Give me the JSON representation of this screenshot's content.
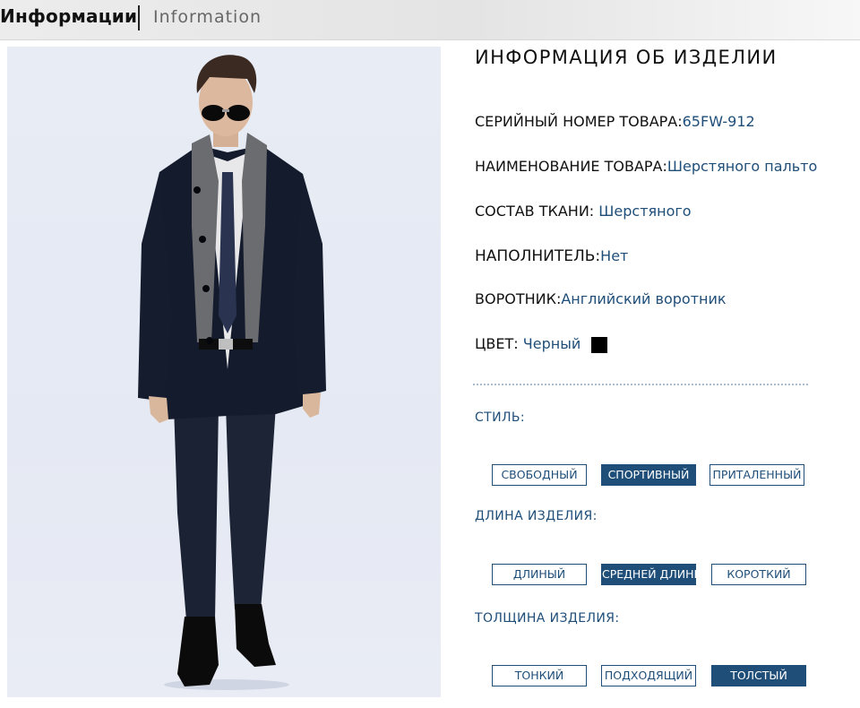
{
  "header": {
    "title": "Информации",
    "subtitle": "Information"
  },
  "info": {
    "title": "ИНФОРМАЦИЯ ОБ ИЗДЕЛИИ",
    "rows": [
      {
        "label": "СЕРИЙНЫЙ НОМЕР ТОВАРА:",
        "value": "65FW-912"
      },
      {
        "label": "НАИМЕНОВАНИЕ ТОВАРА:",
        "value": "Шерстяного пальто"
      },
      {
        "label": "СОСТАВ ТКАНИ: ",
        "value": "Шерстяного"
      },
      {
        "label": "НАПОЛНИТЕЛЬ:",
        "value": "Нет"
      },
      {
        "label": "ВОРОТНИК:",
        "value": "Английский воротник"
      },
      {
        "label": "ЦВЕТ: ",
        "value": "Черный"
      }
    ],
    "color_swatch": "#000000"
  },
  "style": {
    "label": "СТИЛЬ:",
    "options": [
      "СВОБОДНЫЙ",
      "СПОРТИВНЫЙ",
      "ПРИТАЛЕННЫЙ"
    ],
    "selected": "СПОРТИВНЫЙ"
  },
  "length": {
    "label": "ДЛИНА ИЗДЕЛИЯ:",
    "options": [
      "ДЛИНЫЙ",
      "СРЕДНЕЙ ДЛИНЫ",
      "КОРОТКИЙ"
    ],
    "selected": "СРЕДНЕЙ ДЛИНЫ"
  },
  "thickness": {
    "label": "ТОЛЩИНА ИЗДЕЛИЯ:",
    "options": [
      "ТОНКИЙ",
      "ПОДХОДЯЩИЙ",
      "ТОЛСТЫЙ"
    ],
    "selected": "ТОЛСТЫЙ"
  },
  "colors": {
    "accent": "#1f4e79",
    "text": "#111111",
    "panel_bg": "#e8ecf5"
  }
}
